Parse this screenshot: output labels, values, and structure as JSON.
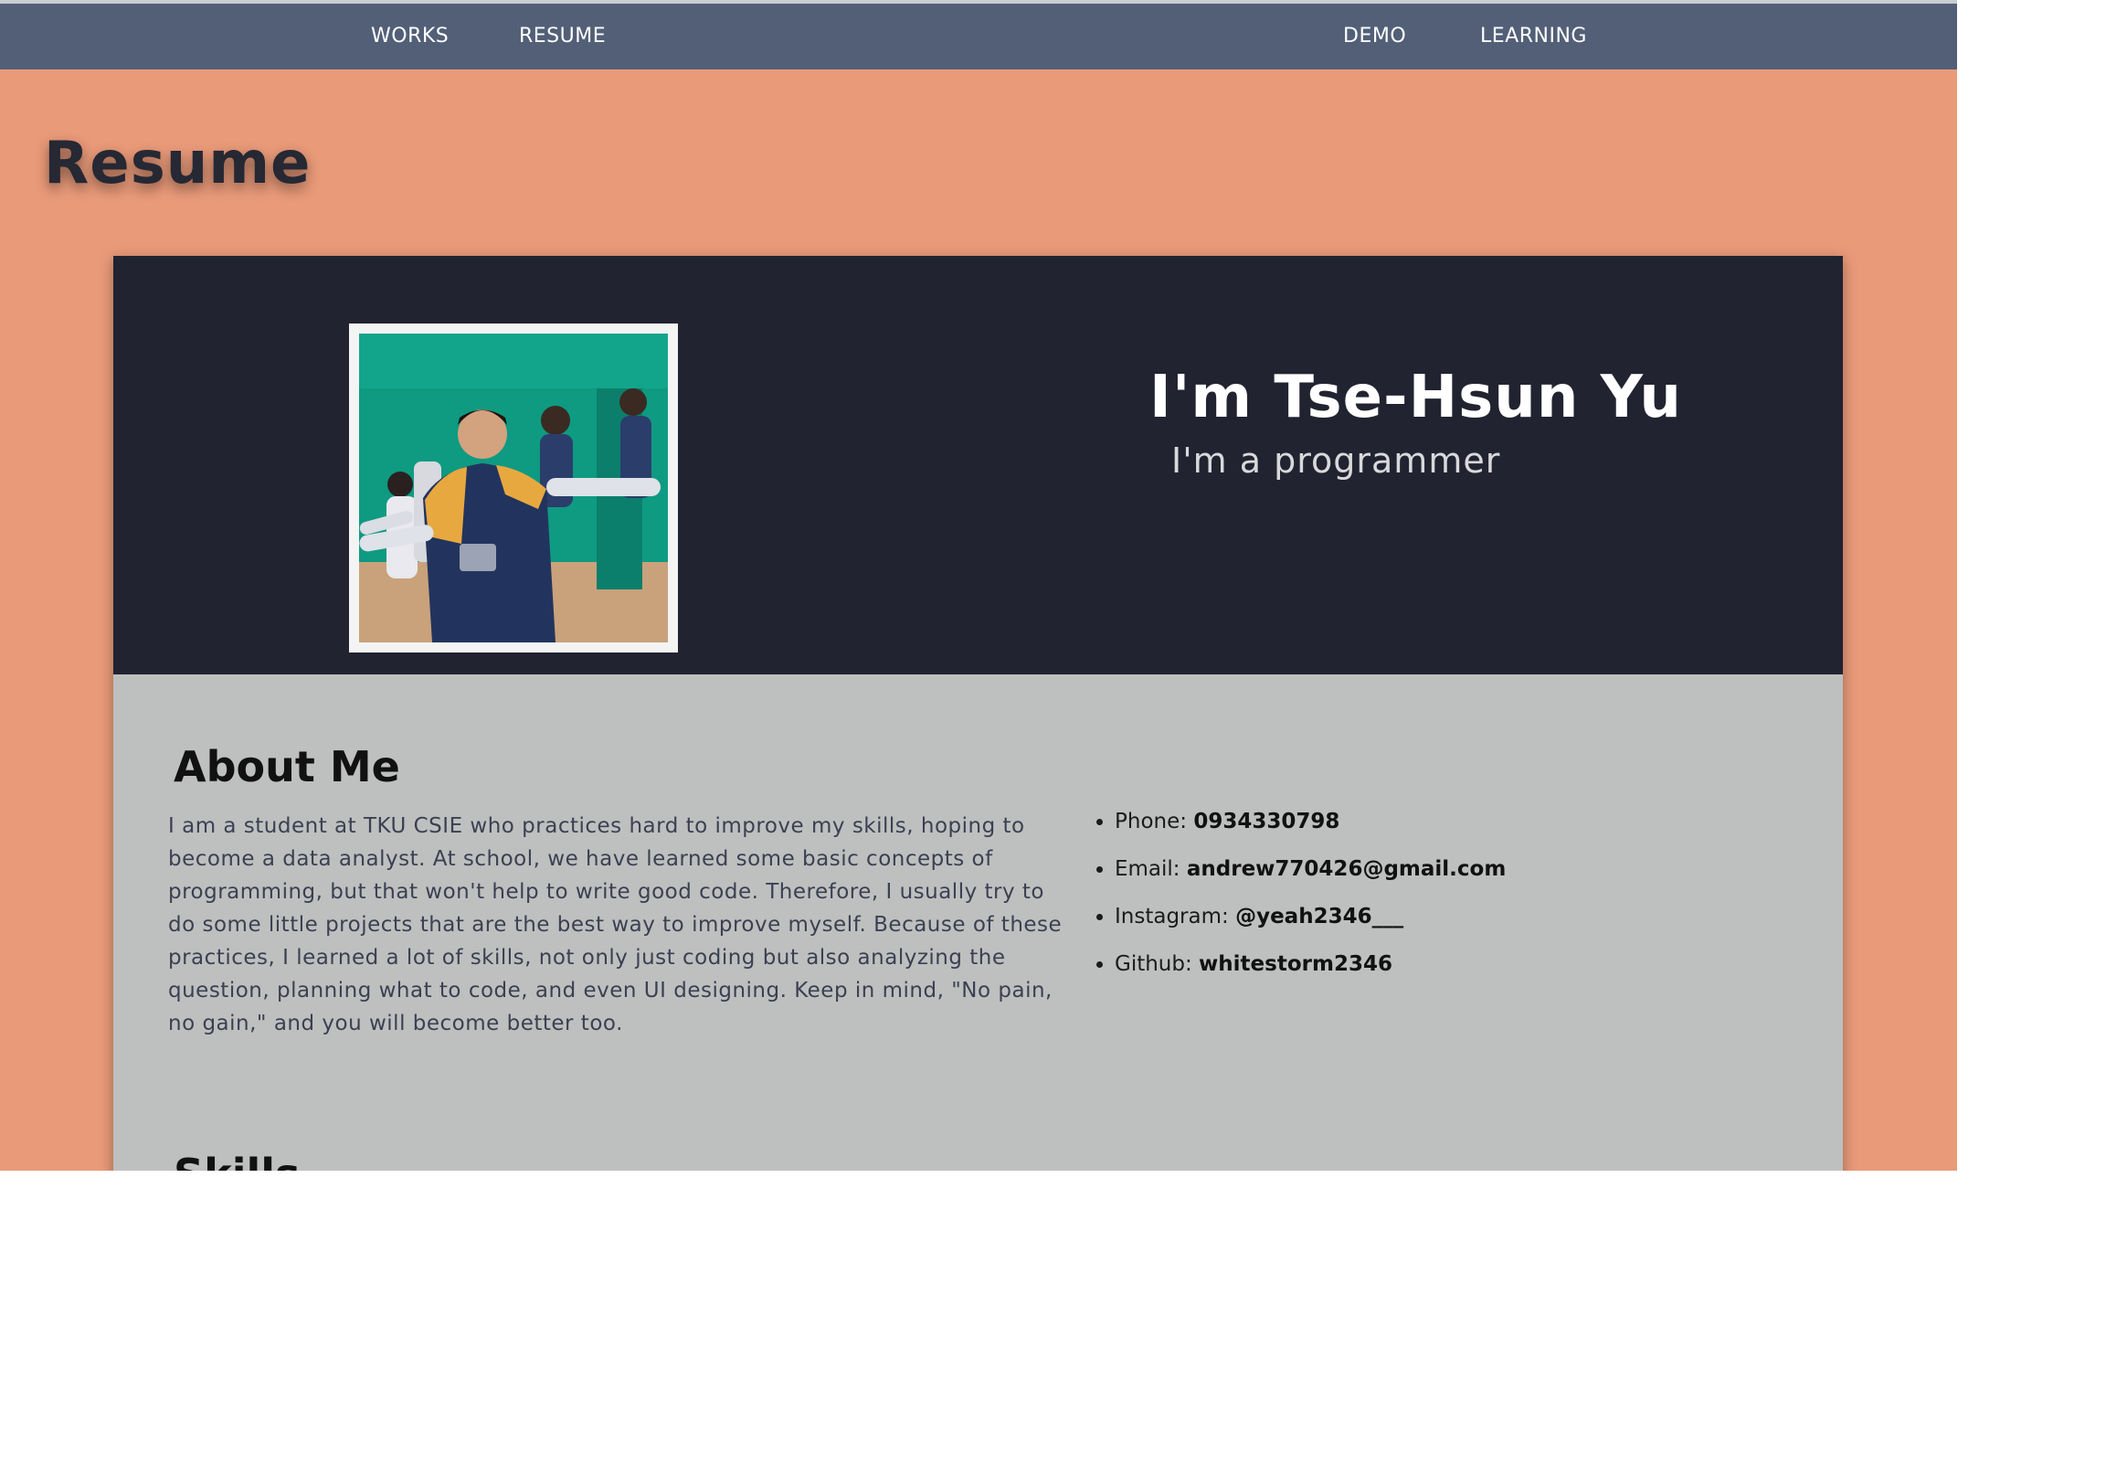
{
  "nav": {
    "left": [
      "WORKS",
      "RESUME"
    ],
    "right": [
      "DEMO",
      "LEARNING"
    ]
  },
  "page_title": "Resume",
  "hero": {
    "name": "I'm Tse-Hsun Yu",
    "tagline": "I'm a programmer"
  },
  "about": {
    "heading": "About Me",
    "text": "I am a student at TKU CSIE who practices hard to improve my skills, hoping to become a data analyst. At school, we have learned some basic concepts of programming, but that won't help to write good code. Therefore, I usually try to do some little projects that are the best way to improve myself. Because of these practices, I learned a lot of skills, not only just coding but also analyzing the question, planning what to code, and even UI designing. Keep in mind, \"No pain, no gain,\" and you will become better too."
  },
  "contact": [
    {
      "label": "Phone: ",
      "value": "0934330798"
    },
    {
      "label": "Email: ",
      "value": "andrew770426@gmail.com"
    },
    {
      "label": "Instagram: ",
      "value": "@yeah2346___"
    },
    {
      "label": "Github: ",
      "value": "whitestorm2346"
    }
  ],
  "skills_heading": "Skills",
  "colors": {
    "navbar": "#525f77",
    "page_background": "#e99a79",
    "hero_background": "#212330",
    "content_background": "#bec0bf"
  }
}
